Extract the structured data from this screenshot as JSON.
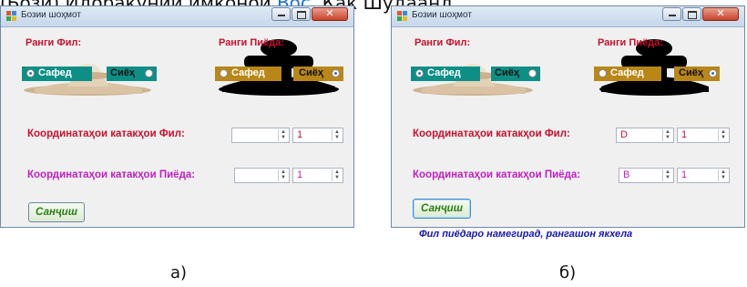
{
  "header_fragment": {
    "text_before": "(Бозӣ) Идоракунии имконои ",
    "highlight": "Вос.",
    "text_after": " Как Шудаанд"
  },
  "colors": {
    "window_bg": "#f0f0f0",
    "label_red": "#c8102e",
    "label_magenta": "#c020c0",
    "radio_teal": "#0d8f86",
    "radio_gold": "#b88717",
    "button_text_green": "#2c7d16",
    "message_blue": "#1616b4"
  },
  "panels": [
    {
      "caption": "а)",
      "window_title": "Бозии шоҳмот",
      "close_symbol": "✕",
      "bishop_group": {
        "legend": "Ранги Фил:",
        "icon": "white-bishop-chess-piece",
        "options": [
          {
            "label": "Сафед",
            "checked": true,
            "bg": "#0d8f86"
          },
          {
            "label": "Сиёҳ",
            "checked": false,
            "bg": "#0d8f86"
          }
        ]
      },
      "pawn_group": {
        "legend": "Ранги Пиёда:",
        "icon": "black-pawn-chess-piece",
        "options": [
          {
            "label": "Сафед",
            "checked": false,
            "bg": "#b88717"
          },
          {
            "label": "Сиёҳ",
            "checked": true,
            "bg": "#b88717"
          }
        ]
      },
      "bishop_row": {
        "label": "Координатаҳои катакҳои Фил:",
        "letter": "",
        "number": "1"
      },
      "pawn_row": {
        "label": "Координатаҳои катакҳои Пиёда:",
        "letter": "",
        "number": "1"
      },
      "button_label": "Санҷиш",
      "message": ""
    },
    {
      "caption": "б)",
      "window_title": "Бозии шоҳмот",
      "close_symbol": "✕",
      "bishop_group": {
        "legend": "Ранги Фил:",
        "icon": "white-bishop-chess-piece",
        "options": [
          {
            "label": "Сафед",
            "checked": true,
            "bg": "#0d8f86"
          },
          {
            "label": "Сиёҳ",
            "checked": false,
            "bg": "#0d8f86"
          }
        ]
      },
      "pawn_group": {
        "legend": "Ранги Пиёда:",
        "icon": "black-pawn-chess-piece",
        "options": [
          {
            "label": "Сафед",
            "checked": false,
            "bg": "#b88717"
          },
          {
            "label": "Сиёҳ",
            "checked": true,
            "bg": "#b88717"
          }
        ]
      },
      "bishop_row": {
        "label": "Координатаҳои катакҳои Фил:",
        "letter": "D",
        "number": "1"
      },
      "pawn_row": {
        "label": "Координатаҳои катакҳои Пиёда:",
        "letter": "B",
        "number": "1"
      },
      "button_label": "Санҷиш",
      "message": "Фил пиёдаро намегирад, рангашон якхела"
    }
  ]
}
